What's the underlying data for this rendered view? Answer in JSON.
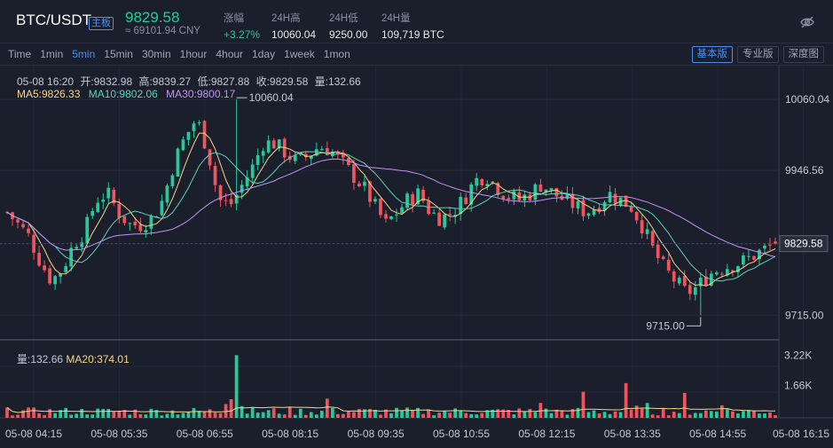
{
  "header": {
    "pair": "BTC/USDT",
    "badge": "主板",
    "price": "9829.58",
    "cny": "≈ 69101.94 CNY",
    "change_label": "涨幅",
    "change_value": "+3.27%",
    "high_label": "24H高",
    "high_value": "10060.04",
    "low_label": "24H低",
    "low_value": "9250.00",
    "volume_label": "24H量",
    "volume_value": "109,719 BTC"
  },
  "toolbar": {
    "intervals": [
      "Time",
      "1min",
      "5min",
      "15min",
      "30min",
      "1hour",
      "4hour",
      "1day",
      "1week",
      "1mon"
    ],
    "active_interval": "5min",
    "views": [
      "基本版",
      "专业版",
      "深度图"
    ],
    "active_view": "基本版"
  },
  "ohlc": {
    "time": "05-08 16:20",
    "open": "开:9832.98",
    "high": "高:9839.27",
    "low": "低:9827.88",
    "close": "收:9829.58",
    "volume": "量:132.66"
  },
  "ma_legend": {
    "ma5": "MA5:9826.33",
    "ma10": "MA10:9802.06",
    "ma30": "MA30:9800.17"
  },
  "vol_legend": {
    "vol": "量:132.66",
    "ma20": "MA20:374.01"
  },
  "colors": {
    "up": "#26c99a",
    "down": "#f0545e",
    "ma5": "#f3d68a",
    "ma10": "#5ed1b8",
    "ma30": "#c393f5",
    "accent": "#4a8ff0"
  },
  "chart_data": {
    "type": "candlestick",
    "price_axis_ticks": [
      "10060.04",
      "9946.56",
      "9829.58",
      "9715.00"
    ],
    "price_axis_values": [
      10060.04,
      9946.56,
      9829.58,
      9715.0
    ],
    "last_price_label": "9829.58",
    "max_marker": "10060.04",
    "min_marker": "9715.00",
    "volume_axis_ticks": [
      "3.22K",
      "1.66K"
    ],
    "volume_axis_values": [
      3220,
      1660
    ],
    "time_labels": [
      "05-08 04:15",
      "05-08 05:35",
      "05-08 06:55",
      "05-08 08:15",
      "05-08 09:35",
      "05-08 10:55",
      "05-08 12:15",
      "05-08 13:35",
      "05-08 14:55",
      "05-08 16:15"
    ],
    "close_path": [
      9880,
      9860,
      9840,
      9800,
      9770,
      9790,
      9830,
      9850,
      9900,
      9910,
      9880,
      9860,
      9860,
      9870,
      9900,
      9960,
      10000,
      10030,
      9980,
      9900,
      9890,
      9920,
      9950,
      9990,
      9990,
      9975,
      9960,
      9970,
      9985,
      9980,
      9960,
      9940,
      9920,
      9890,
      9860,
      9880,
      9900,
      9910,
      9880,
      9870,
      9880,
      9900,
      9930,
      9940,
      9920,
      9905,
      9900,
      9910,
      9925,
      9910,
      9900,
      9890,
      9880,
      9890,
      9910,
      9900,
      9890,
      9860,
      9820,
      9790,
      9770,
      9750,
      9760,
      9780,
      9790,
      9795,
      9800,
      9810,
      9820,
      9830
    ]
  }
}
